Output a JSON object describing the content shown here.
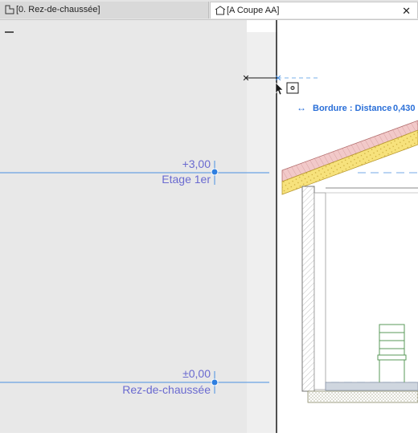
{
  "tabs": [
    {
      "label": "[0. Rez-de-chaussée]",
      "icon": "floor-plan-icon"
    },
    {
      "label": "[A Coupe AA]",
      "icon": "section-icon"
    }
  ],
  "tab_close_symbol": "✕",
  "tracker": {
    "arrow": "↔",
    "label": "Bordure : Distance",
    "value": "0,430"
  },
  "stories": [
    {
      "elevation": "+3,00",
      "name": "Etage 1er"
    },
    {
      "elevation": "±0,00",
      "name": "Rez-de-chaussée"
    }
  ],
  "colors": {
    "story_line": "#4a8fe0",
    "story_text": "#6a6ad0",
    "tracker_text": "#2a6fd8",
    "outside_area": "#e8e8e8",
    "roof_pink": "#f2c9c9",
    "insulation": "#f7e27c"
  }
}
